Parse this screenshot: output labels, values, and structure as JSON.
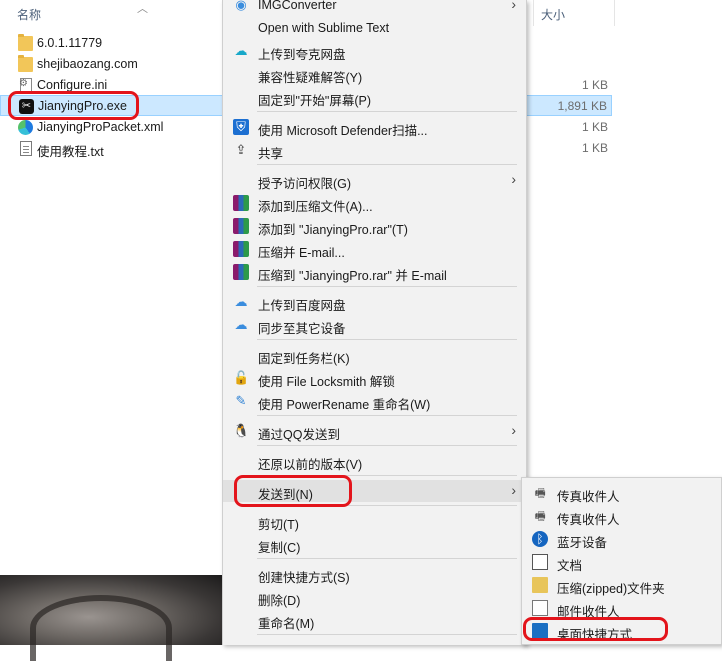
{
  "explorer": {
    "columns": {
      "name": "名称",
      "size": "大小"
    },
    "files": [
      {
        "name": "6.0.1.11779",
        "size": "",
        "icon": "folder-icon"
      },
      {
        "name": "shejibaozang.com",
        "size": "",
        "icon": "folder-icon"
      },
      {
        "name": "Configure.ini",
        "size": "1 KB",
        "icon": "settings-file-icon"
      },
      {
        "name": "JianyingPro.exe",
        "size": "1,891 KB",
        "icon": "capcut-app-icon"
      },
      {
        "name": "JianyingProPacket.xml",
        "size": "1 KB",
        "icon": "edge-xml-icon"
      },
      {
        "name": "使用教程.txt",
        "size": "1 KB",
        "icon": "text-file-icon"
      }
    ],
    "selected_index": 3
  },
  "context_menu": {
    "items": [
      {
        "label": "IMGConverter",
        "icon": "imgconverter-icon",
        "submenu": true
      },
      {
        "label": "Open with Sublime Text",
        "icon": ""
      },
      {
        "label": "上传到夸克网盘",
        "icon": "quark-cloud-icon"
      },
      {
        "label": "兼容性疑难解答(Y)",
        "icon": ""
      },
      {
        "label": "固定到\"开始\"屏幕(P)",
        "icon": ""
      },
      {
        "label": "使用 Microsoft Defender扫描...",
        "icon": "defender-shield-icon"
      },
      {
        "label": "共享",
        "icon": "share-icon"
      },
      {
        "label": "授予访问权限(G)",
        "icon": "",
        "submenu": true
      },
      {
        "label": "添加到压缩文件(A)...",
        "icon": "winrar-icon"
      },
      {
        "label": "添加到 \"JianyingPro.rar\"(T)",
        "icon": "winrar-icon"
      },
      {
        "label": "压缩并 E-mail...",
        "icon": "winrar-icon"
      },
      {
        "label": "压缩到 \"JianyingPro.rar\" 并 E-mail",
        "icon": "winrar-icon"
      },
      {
        "label": "上传到百度网盘",
        "icon": "baidu-cloud-icon"
      },
      {
        "label": "同步至其它设备",
        "icon": "baidu-cloud-icon"
      },
      {
        "label": "固定到任务栏(K)",
        "icon": ""
      },
      {
        "label": "使用 File Locksmith 解锁",
        "icon": "lock-icon"
      },
      {
        "label": "使用 PowerRename 重命名(W)",
        "icon": "rename-icon"
      },
      {
        "label": "通过QQ发送到",
        "icon": "qq-icon",
        "submenu": true
      },
      {
        "label": "还原以前的版本(V)",
        "icon": ""
      },
      {
        "label": "发送到(N)",
        "icon": "",
        "submenu": true
      },
      {
        "label": "剪切(T)",
        "icon": ""
      },
      {
        "label": "复制(C)",
        "icon": ""
      },
      {
        "label": "创建快捷方式(S)",
        "icon": ""
      },
      {
        "label": "删除(D)",
        "icon": ""
      },
      {
        "label": "重命名(M)",
        "icon": ""
      }
    ]
  },
  "send_to_menu": {
    "items": [
      {
        "label": "传真收件人",
        "icon": "fax-icon"
      },
      {
        "label": "传真收件人",
        "icon": "fax-icon"
      },
      {
        "label": "蓝牙设备",
        "icon": "bluetooth-icon"
      },
      {
        "label": "文档",
        "icon": "documents-icon"
      },
      {
        "label": "压缩(zipped)文件夹",
        "icon": "zip-folder-icon"
      },
      {
        "label": "邮件收件人",
        "icon": "mail-icon"
      },
      {
        "label": "桌面快捷方式",
        "icon": "desktop-icon"
      }
    ]
  },
  "highlight_color": "#e3141b"
}
